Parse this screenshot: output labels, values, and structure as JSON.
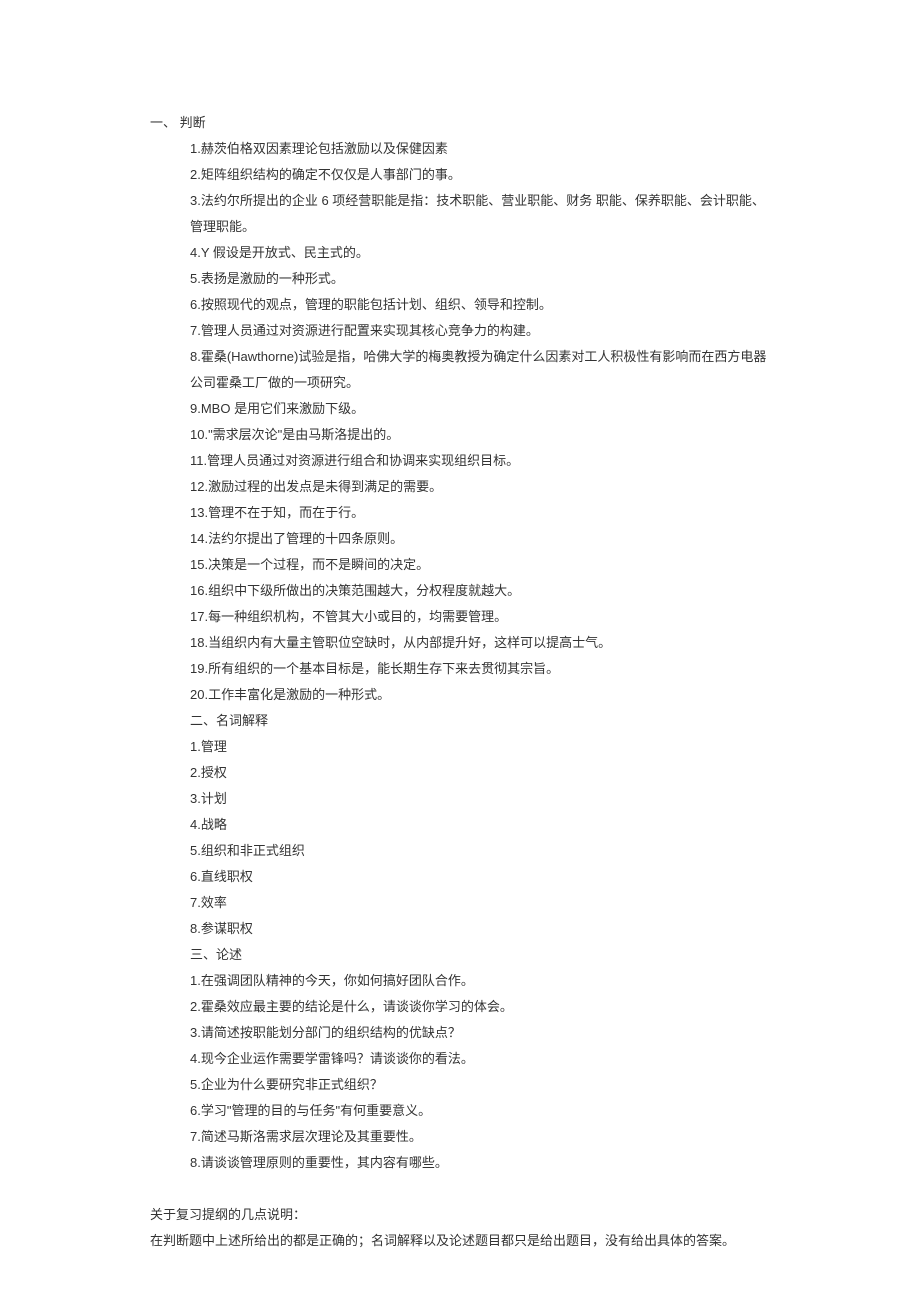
{
  "section1": {
    "title": "一、 判断",
    "items": [
      "1.赫茨伯格双因素理论包括激励以及保健因素",
      "2.矩阵组织结构的确定不仅仅是人事部门的事。",
      "3.法约尔所提出的企业 6 项经营职能是指：技术职能、营业职能、财务  职能、保养职能、会计职能、管理职能。",
      "4.Y 假设是开放式、民主式的。",
      "5.表扬是激励的一种形式。",
      "6.按照现代的观点，管理的职能包括计划、组织、领导和控制。",
      "7.管理人员通过对资源进行配置来实现其核心竞争力的构建。",
      "8.霍桑(Hawthorne)试验是指，哈佛大学的梅奥教授为确定什么因素对工人积极性有影响而在西方电器公司霍桑工厂做的一项研究。",
      "9.MBO 是用它们来激励下级。",
      "10.\"需求层次论\"是由马斯洛提出的。",
      "11.管理人员通过对资源进行组合和协调来实现组织目标。",
      "12.激励过程的出发点是未得到满足的需要。",
      "13.管理不在于知，而在于行。",
      "14.法约尔提出了管理的十四条原则。",
      "15.决策是一个过程，而不是瞬间的决定。",
      "16.组织中下级所做出的决策范围越大，分权程度就越大。",
      "17.每一种组织机构，不管其大小或目的，均需要管理。",
      "18.当组织内有大量主管职位空缺时，从内部提升好，这样可以提高士气。",
      "19.所有组织的一个基本目标是，能长期生存下来去贯彻其宗旨。",
      "20.工作丰富化是激励的一种形式。"
    ]
  },
  "section2": {
    "title": "二、名词解释",
    "items": [
      "1.管理",
      "2.授权",
      "3.计划",
      "4.战略",
      "5.组织和非正式组织",
      "6.直线职权",
      "7.效率",
      "8.参谋职权"
    ]
  },
  "section3": {
    "title": "三、论述",
    "items": [
      "1.在强调团队精神的今天，你如何搞好团队合作。",
      "2.霍桑效应最主要的结论是什么，请谈谈你学习的体会。",
      "3.请简述按职能划分部门的组织结构的优缺点？",
      "4.现今企业运作需要学雷锋吗？请谈谈你的看法。",
      "5.企业为什么要研究非正式组织？",
      "6.学习\"管理的目的与任务\"有何重要意义。",
      "7.简述马斯洛需求层次理论及其重要性。",
      "8.请谈谈管理原则的重要性，其内容有哪些。"
    ]
  },
  "notes": [
    "关于复习提纲的几点说明：",
    "在判断题中上述所给出的都是正确的；名词解释以及论述题目都只是给出题目，没有给出具体的答案。"
  ]
}
